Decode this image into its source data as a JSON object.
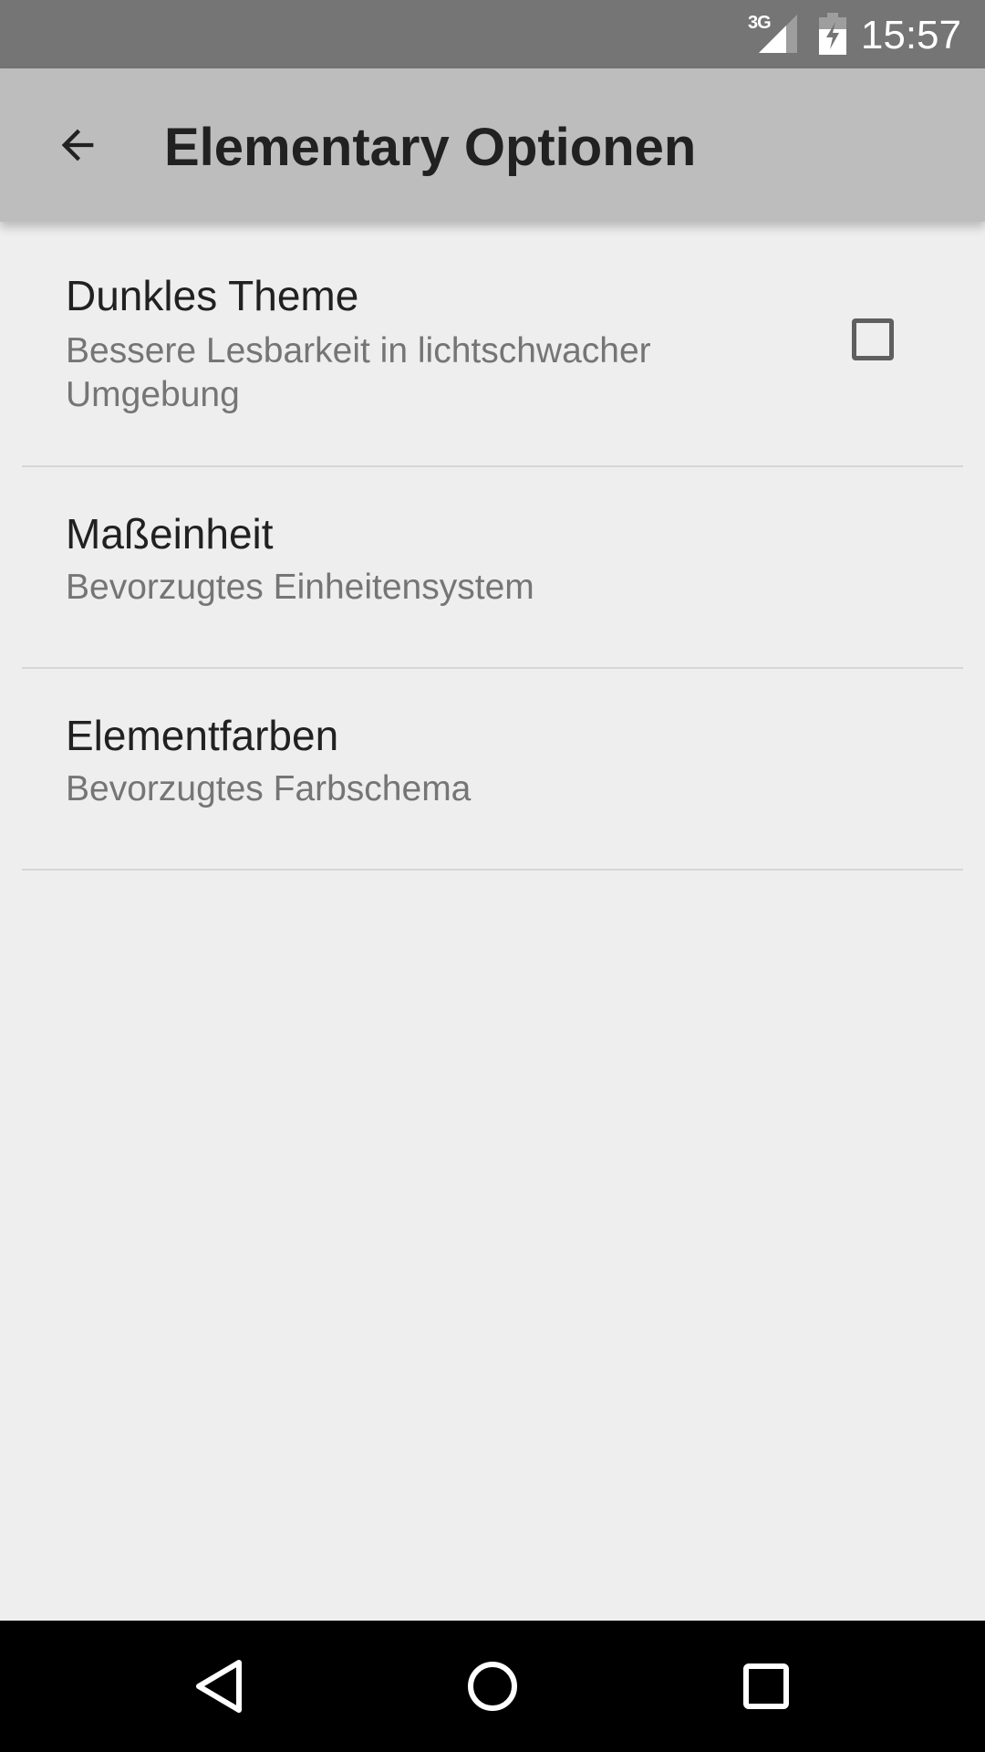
{
  "status_bar": {
    "network": "3G",
    "time": "15:57",
    "icons": [
      "signal-icon",
      "battery-charging-icon"
    ]
  },
  "app_bar": {
    "title": "Elementary Optionen",
    "back_icon": "arrow-back-icon"
  },
  "preferences": [
    {
      "title": "Dunkles Theme",
      "summary": "Bessere Lesbarkeit in lichtschwacher Umgebung",
      "checkbox_checked": false
    },
    {
      "title": "Maßeinheit",
      "summary": "Bevorzugtes Einheitensystem"
    },
    {
      "title": "Elementfarben",
      "summary": "Bevorzugtes Farbschema"
    }
  ],
  "nav_bar": {
    "icons": [
      "back-triangle-icon",
      "home-circle-icon",
      "recents-square-icon"
    ]
  },
  "colors": {
    "status_bar": "#757575",
    "app_bar": "#bdbdbd",
    "background": "#eeeeee",
    "nav_bar": "#000000"
  }
}
